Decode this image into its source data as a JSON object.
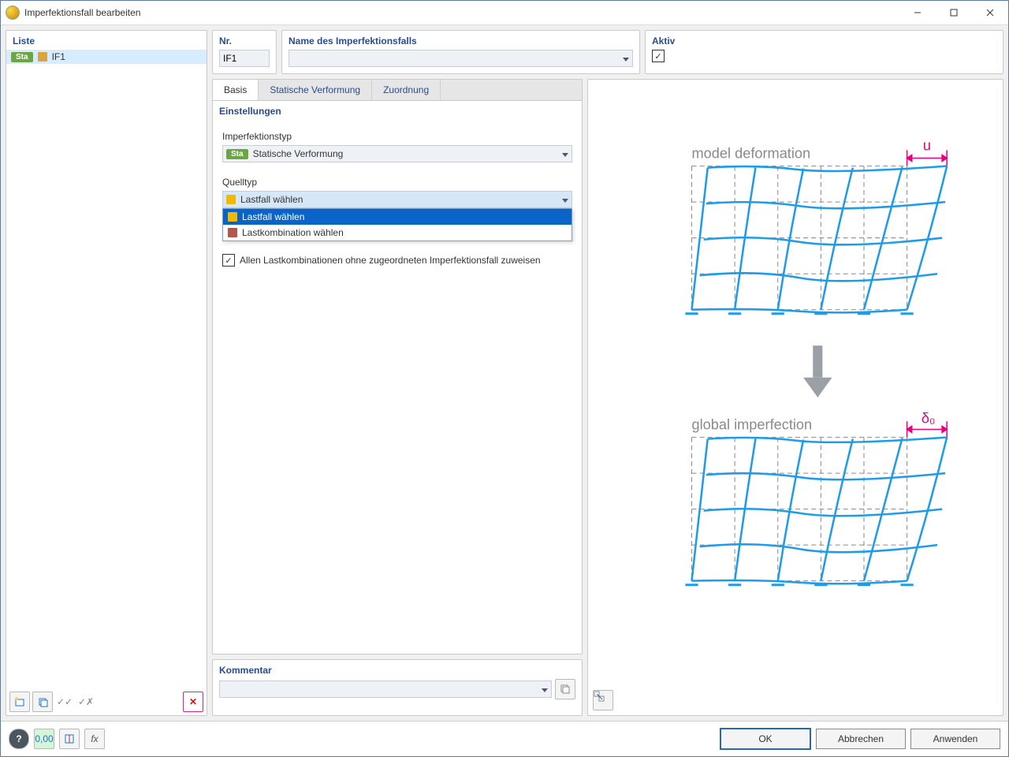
{
  "window": {
    "title": "Imperfektionsfall bearbeiten"
  },
  "list": {
    "title": "Liste",
    "items": [
      {
        "tag": "Sta",
        "ifLabel": "IF1"
      }
    ]
  },
  "header": {
    "nrTitle": "Nr.",
    "nrValue": "IF1",
    "nameTitle": "Name des Imperfektionsfalls",
    "nameValue": "",
    "aktivTitle": "Aktiv",
    "aktivChecked": "✓"
  },
  "tabs": {
    "t0": "Basis",
    "t1": "Statische Verformung",
    "t2": "Zuordnung"
  },
  "settings": {
    "title": "Einstellungen",
    "typeLabel": "Imperfektionstyp",
    "typeTag": "Sta",
    "typeValue": "Statische Verformung",
    "quelltypLabel": "Quelltyp",
    "quelltypValue": "Lastfall wählen",
    "ddOptions": {
      "o0": "Lastfall wählen",
      "o1": "Lastkombination wählen"
    },
    "assignAll": "Allen Lastkombinationen ohne zugeordneten Imperfektionsfall zuweisen",
    "assignAllChecked": "✓"
  },
  "kommentar": {
    "title": "Kommentar",
    "value": ""
  },
  "preview": {
    "topLabel": "model deformation",
    "topSymbol": "u",
    "bottomLabel": "global imperfection",
    "bottomSymbol": "δ₀"
  },
  "footer": {
    "ok": "OK",
    "cancel": "Abbrechen",
    "apply": "Anwenden"
  }
}
